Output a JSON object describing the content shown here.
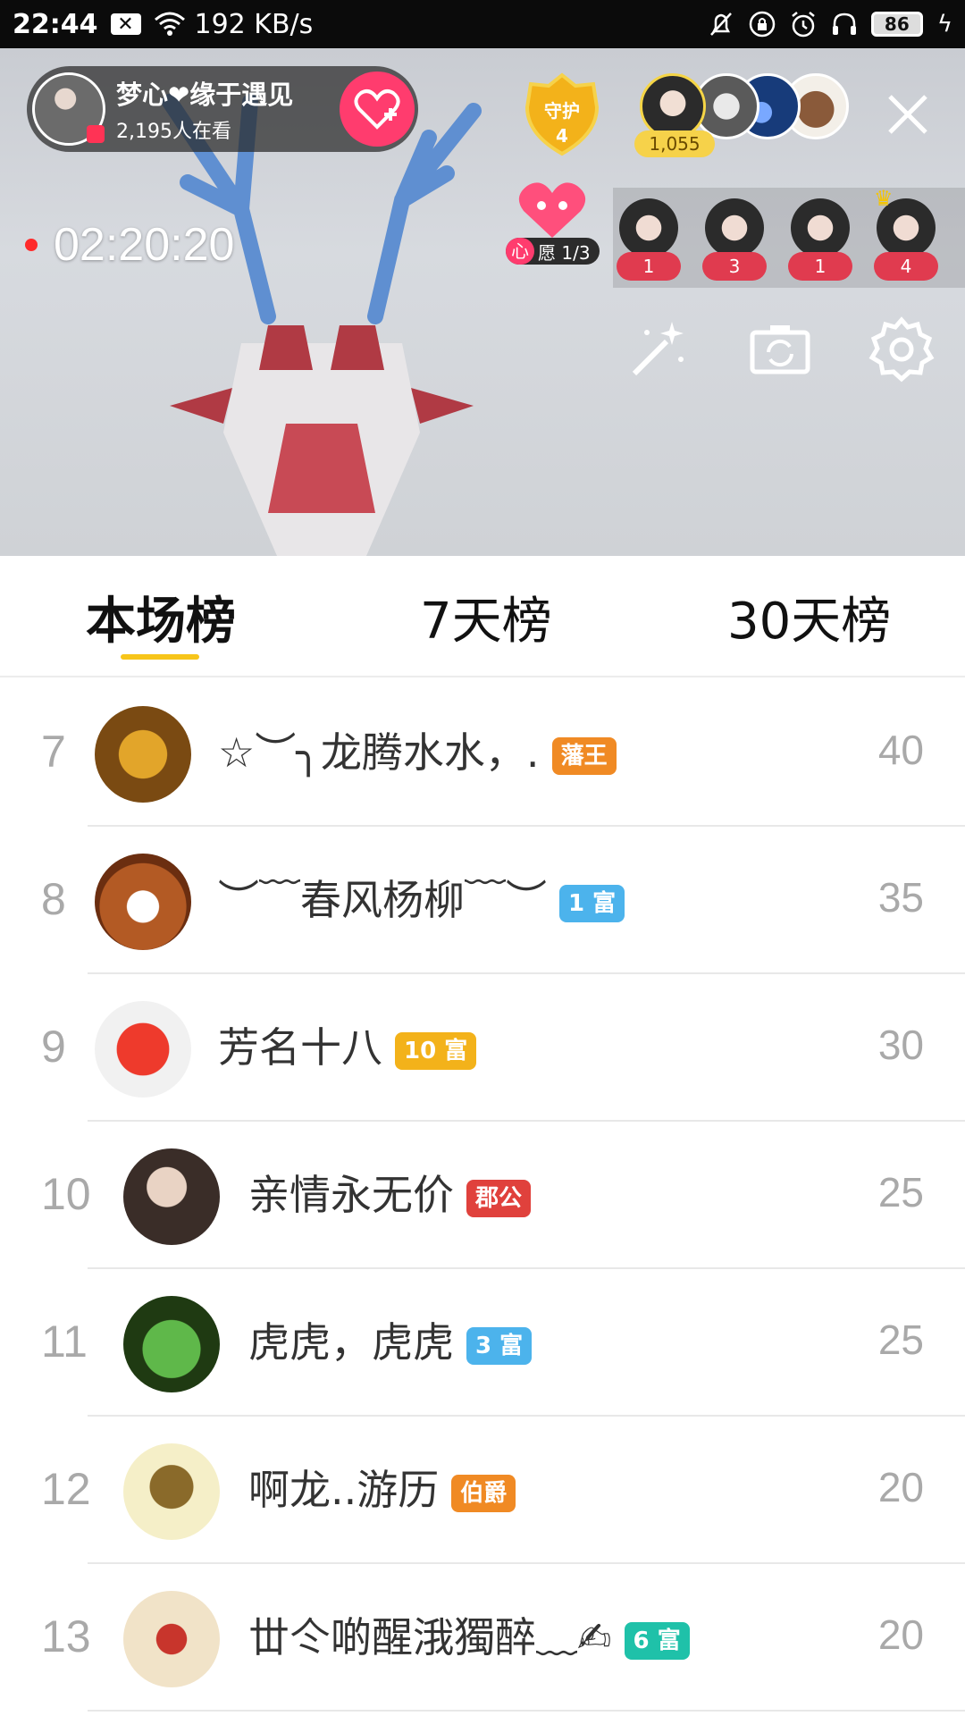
{
  "status_bar": {
    "time": "22:44",
    "speed": "192 KB/s",
    "battery": "86"
  },
  "live": {
    "host_name": "梦心❤缘于遇见",
    "viewers": "2,195人在看",
    "guard_label": "守护",
    "guard_count": "4",
    "viewer_score": "1,055",
    "timer": "02:20:20",
    "wish_label_a": "心",
    "wish_label_b": "愿 1/3",
    "gift_counts": [
      "1",
      "3",
      "1",
      "4"
    ]
  },
  "tabs": [
    {
      "label": "本场榜",
      "active": true
    },
    {
      "label": "7天榜",
      "active": false
    },
    {
      "label": "30天榜",
      "active": false
    }
  ],
  "ranking": [
    {
      "rank": "7",
      "name": "☆︶╮龙腾水水，.",
      "badge": "藩王",
      "badge_color": "#f08a24",
      "score": "40"
    },
    {
      "rank": "8",
      "name": "︶﹋春风杨柳﹋︶",
      "badge": "1 富",
      "badge_color": "#4cb3ec",
      "score": "35"
    },
    {
      "rank": "9",
      "name": "芳名十八",
      "badge": "10 富",
      "badge_color": "#f3b21a",
      "score": "30"
    },
    {
      "rank": "10",
      "name": "亲情永无价",
      "badge": "郡公",
      "badge_color": "#e0413c",
      "score": "25"
    },
    {
      "rank": "11",
      "name": "虎虎，虎虎",
      "badge": "3 富",
      "badge_color": "#4cb3ec",
      "score": "25"
    },
    {
      "rank": "12",
      "name": "啊龙..游历",
      "badge": "伯爵",
      "badge_color": "#f08a24",
      "score": "20"
    },
    {
      "rank": "13",
      "name": "丗仒啲醒涐獨醉﹏✍",
      "badge": "6 富",
      "badge_color": "#1fc1a9",
      "score": "20"
    }
  ]
}
